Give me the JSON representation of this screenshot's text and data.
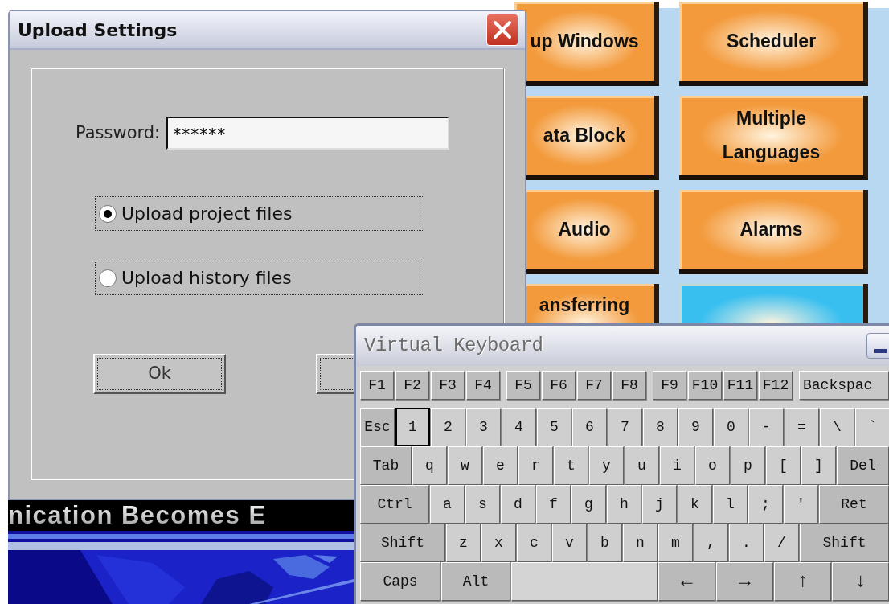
{
  "hmi": {
    "buttons": [
      {
        "label": "up Windows",
        "color": "#f39a3c"
      },
      {
        "label": "ata Block",
        "color": "#f39a3c"
      },
      {
        "label": "Audio",
        "color": "#f39a3c"
      },
      {
        "label": "ansferring",
        "color": "#f39a3c"
      },
      {
        "label": "Scheduler",
        "color": "#f39a3c"
      },
      {
        "label": "Multiple Languages",
        "color": "#f39a3c"
      },
      {
        "label": "Alarms",
        "color": "#f39a3c"
      },
      {
        "color": "#38bff0"
      }
    ],
    "banner": {
      "text": "nication Becomes E"
    }
  },
  "dialog": {
    "title": "Upload Settings",
    "password": {
      "label": "Password:",
      "value": "******"
    },
    "options": [
      {
        "label": "Upload project files",
        "selected": true
      },
      {
        "label": "Upload history files",
        "selected": false
      }
    ],
    "buttons": [
      {
        "label": "Ok"
      }
    ]
  },
  "keyboard": {
    "title": "Virtual Keyboard",
    "function_groups": [
      [
        "F1",
        "F2",
        "F3",
        "F4"
      ],
      [
        "F5",
        "F6",
        "F7",
        "F8"
      ],
      [
        "F9",
        "F10",
        "F11",
        "F12"
      ]
    ],
    "backspace": "Backspac",
    "rows": [
      {
        "keys": [
          {
            "label": "Esc",
            "kind": "esc",
            "focused": false
          },
          {
            "label": "1",
            "kind": "char",
            "focused": true
          },
          {
            "label": "2",
            "kind": "char",
            "focused": false
          },
          {
            "label": "3",
            "kind": "char",
            "focused": false
          },
          {
            "label": "4",
            "kind": "char",
            "focused": false
          },
          {
            "label": "5",
            "kind": "char",
            "focused": false
          },
          {
            "label": "6",
            "kind": "char",
            "focused": false
          },
          {
            "label": "7",
            "kind": "char",
            "focused": false
          },
          {
            "label": "8",
            "kind": "char",
            "focused": false
          },
          {
            "label": "9",
            "kind": "char",
            "focused": false
          },
          {
            "label": "0",
            "kind": "char",
            "focused": false
          },
          {
            "label": "-",
            "kind": "char",
            "focused": false
          },
          {
            "label": "=",
            "kind": "char",
            "focused": false
          },
          {
            "label": "\\",
            "kind": "char",
            "focused": false
          },
          {
            "label": "`",
            "kind": "char",
            "focused": false
          }
        ]
      },
      {
        "keys": [
          {
            "label": "Tab",
            "kind": "tab",
            "focused": false
          },
          {
            "label": "q",
            "kind": "char",
            "focused": false
          },
          {
            "label": "w",
            "kind": "char",
            "focused": false
          },
          {
            "label": "e",
            "kind": "char",
            "focused": false
          },
          {
            "label": "r",
            "kind": "char",
            "focused": false
          },
          {
            "label": "t",
            "kind": "char",
            "focused": false
          },
          {
            "label": "y",
            "kind": "char",
            "focused": false
          },
          {
            "label": "u",
            "kind": "char",
            "focused": false
          },
          {
            "label": "i",
            "kind": "char",
            "focused": false
          },
          {
            "label": "o",
            "kind": "char",
            "focused": false
          },
          {
            "label": "p",
            "kind": "char",
            "focused": false
          },
          {
            "label": "[",
            "kind": "char",
            "focused": false
          },
          {
            "label": "]",
            "kind": "char",
            "focused": false
          },
          {
            "label": "Del",
            "kind": "end",
            "focused": false
          }
        ]
      },
      {
        "keys": [
          {
            "label": "Ctrl",
            "kind": "ctrl",
            "focused": false
          },
          {
            "label": "a",
            "kind": "char",
            "focused": false
          },
          {
            "label": "s",
            "kind": "char",
            "focused": false
          },
          {
            "label": "d",
            "kind": "char",
            "focused": false
          },
          {
            "label": "f",
            "kind": "char",
            "focused": false
          },
          {
            "label": "g",
            "kind": "char",
            "focused": false
          },
          {
            "label": "h",
            "kind": "char",
            "focused": false
          },
          {
            "label": "j",
            "kind": "char",
            "focused": false
          },
          {
            "label": "k",
            "kind": "char",
            "focused": false
          },
          {
            "label": "l",
            "kind": "char",
            "focused": false
          },
          {
            "label": ";",
            "kind": "char",
            "focused": false
          },
          {
            "label": "'",
            "kind": "char",
            "focused": false
          },
          {
            "label": "Ret",
            "kind": "end",
            "focused": false
          }
        ]
      },
      {
        "keys": [
          {
            "label": "Shift",
            "kind": "shift",
            "focused": false
          },
          {
            "label": "z",
            "kind": "char",
            "focused": false
          },
          {
            "label": "x",
            "kind": "char",
            "focused": false
          },
          {
            "label": "c",
            "kind": "char",
            "focused": false
          },
          {
            "label": "v",
            "kind": "char",
            "focused": false
          },
          {
            "label": "b",
            "kind": "char",
            "focused": false
          },
          {
            "label": "n",
            "kind": "char",
            "focused": false
          },
          {
            "label": "m",
            "kind": "char",
            "focused": false
          },
          {
            "label": ",",
            "kind": "char",
            "focused": false
          },
          {
            "label": ".",
            "kind": "char",
            "focused": false
          },
          {
            "label": "/",
            "kind": "char",
            "focused": false
          },
          {
            "label": "Shift",
            "kind": "end",
            "focused": false
          }
        ]
      },
      {
        "keys": [
          {
            "label": "Caps",
            "kind": "caps",
            "focused": false
          },
          {
            "label": "Alt",
            "kind": "alt",
            "focused": false
          },
          {
            "kind": "space",
            "focused": false
          },
          {
            "label": "←",
            "kind": "arrow",
            "focused": false
          },
          {
            "label": "→",
            "kind": "arrow",
            "focused": false
          },
          {
            "label": "↑",
            "kind": "arrow",
            "focused": false
          },
          {
            "label": "↓",
            "kind": "arrow",
            "focused": false
          }
        ]
      }
    ]
  }
}
